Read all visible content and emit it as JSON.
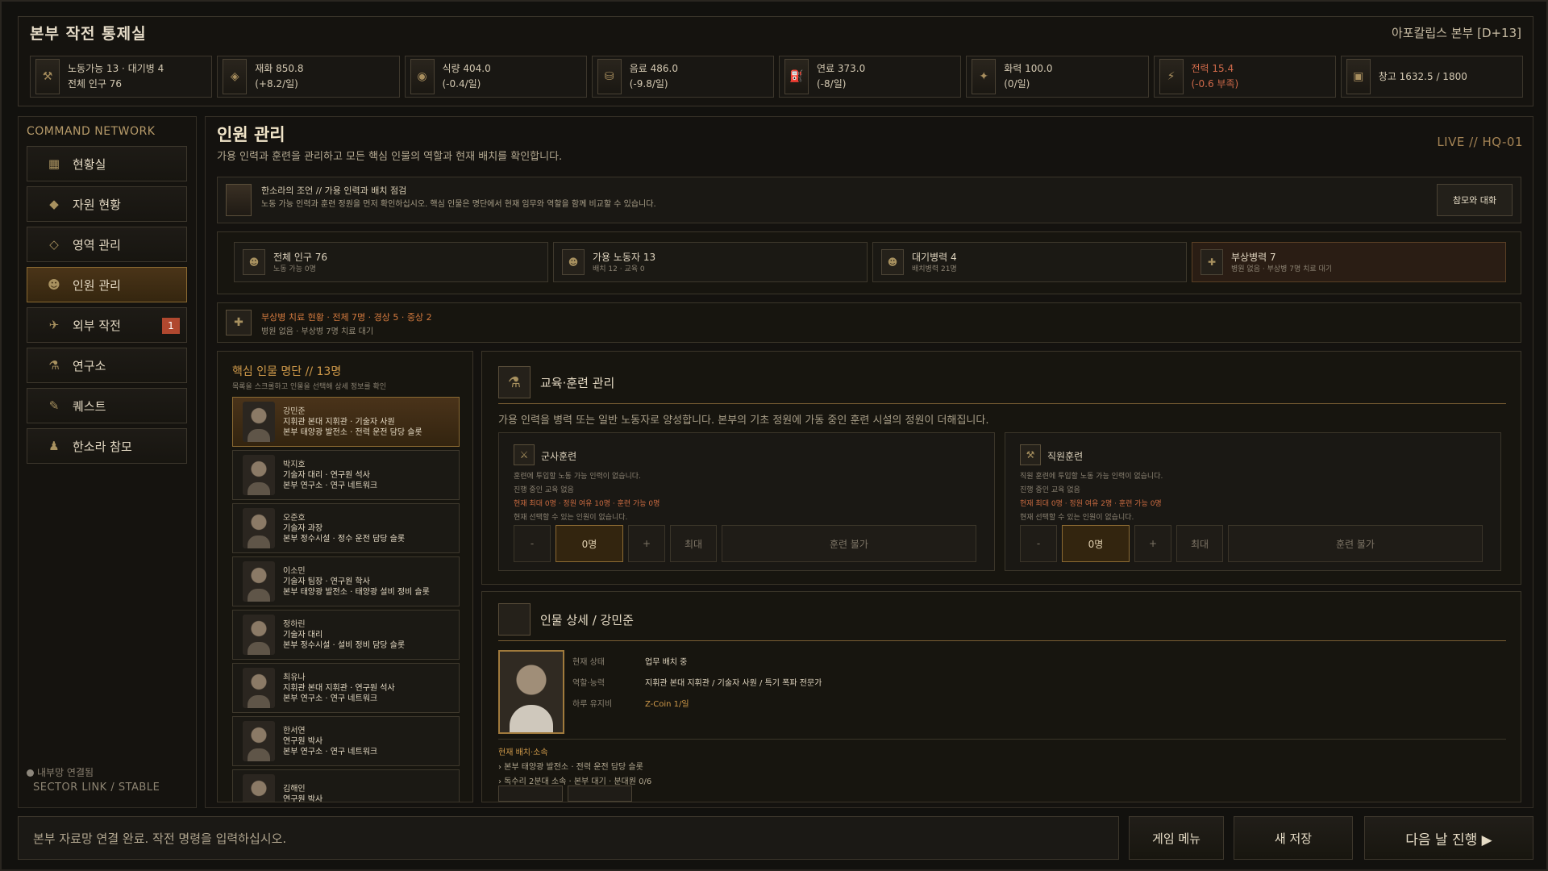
{
  "header": {
    "title": "본부 작전 통제실",
    "status": "아포칼립스 본부 [D+13]"
  },
  "resources": [
    {
      "icon": "worker-icon",
      "line1": "노동가능 13 · 대기병 4",
      "line2": "전체 인구 76",
      "neg": false
    },
    {
      "icon": "material-icon",
      "line1": "재화 850.8",
      "line2": "(+8.2/일)",
      "neg": false
    },
    {
      "icon": "food-icon",
      "line1": "식량 404.0",
      "line2": "(-0.4/일)",
      "neg": false
    },
    {
      "icon": "water-icon",
      "line1": "음료 486.0",
      "line2": "(-9.8/일)",
      "neg": false
    },
    {
      "icon": "fuel-icon",
      "line1": "연료 373.0",
      "line2": "(-8/일)",
      "neg": false
    },
    {
      "icon": "firepower-icon",
      "line1": "화력 100.0",
      "line2": "(0/일)",
      "neg": false
    },
    {
      "icon": "power-icon",
      "line1": "전력 15.4",
      "line2": "(-0.6 부족)",
      "neg": true
    },
    {
      "icon": "storage-icon",
      "line1": "창고 1632.5 / 1800",
      "line2": "",
      "neg": false
    }
  ],
  "sidebar": {
    "title": "COMMAND NETWORK",
    "items": [
      {
        "label": "현황실",
        "icon": "status-room-icon",
        "active": false
      },
      {
        "label": "자원 현황",
        "icon": "resource-icon",
        "active": false
      },
      {
        "label": "영역 관리",
        "icon": "territory-icon",
        "active": false
      },
      {
        "label": "인원 관리",
        "icon": "personnel-icon",
        "active": true
      },
      {
        "label": "외부 작전",
        "icon": "operation-icon",
        "active": false,
        "badge": "1"
      },
      {
        "label": "연구소",
        "icon": "lab-icon",
        "active": false
      },
      {
        "label": "퀘스트",
        "icon": "quest-icon",
        "active": false
      },
      {
        "label": "한소라 참모",
        "icon": "advisor-icon",
        "active": false
      }
    ],
    "net_status": "내부망 연결됨",
    "sector": "SECTOR LINK / STABLE"
  },
  "main": {
    "title": "인원 관리",
    "desc": "가용 인력과 훈련을 관리하고 모든 핵심 인물의 역할과 현재 배치를 확인합니다.",
    "live": "LIVE  //  HQ-01"
  },
  "advisor": {
    "title": "한소라의 조언  //  가용 인력과 배치 점검",
    "text": "노동 가능 인력과 훈련 정원을 먼저 확인하십시오. 핵심 인물은 명단에서 현재 임무와 역할을 함께 비교할 수 있습니다.",
    "button": "참모와 대화"
  },
  "population": [
    {
      "main": "전체 인구 76",
      "sub": "노동 가능 0명",
      "wounded": false
    },
    {
      "main": "가용 노동자 13",
      "sub": "배치 12 · 교육 0",
      "wounded": false
    },
    {
      "main": "대기병력 4",
      "sub": "배치병력 21명",
      "wounded": false
    },
    {
      "main": "부상병력 7",
      "sub": "병원 없음 · 부상병 7명 치료 대기",
      "wounded": true
    }
  ],
  "wound_status": {
    "title": "부상병 치료 현황 · 전체 7명 · 경상 5 · 중상 2",
    "sub": "병원 없음 · 부상병 7명 치료 대기"
  },
  "roster": {
    "title": "핵심 인물 명단  //  13명",
    "sub": "목록을 스크롤하고 인물을 선택해 상세 정보를 확인",
    "people": [
      {
        "name": "강민준",
        "role": "지휘관 본대 지휘관 · 기술자 사원",
        "post": "본부 태양광 발전소 · 전력 운전 담당 슬롯",
        "selected": true
      },
      {
        "name": "박지호",
        "role": "기술자 대리 · 연구원 석사",
        "post": "본부 연구소 · 연구 네트워크",
        "selected": false
      },
      {
        "name": "오준호",
        "role": "기술자 과장",
        "post": "본부 정수시설 · 정수 운전 담당 슬롯",
        "selected": false
      },
      {
        "name": "이소민",
        "role": "기술자 팀장 · 연구원 학사",
        "post": "본부 태양광 발전소 · 태양광 설비 정비 슬롯",
        "selected": false
      },
      {
        "name": "정하린",
        "role": "기술자 대리",
        "post": "본부 정수시설 · 설비 정비 담당 슬롯",
        "selected": false
      },
      {
        "name": "최유나",
        "role": "지휘관 본대 지휘관 · 연구원 석사",
        "post": "본부 연구소 · 연구 네트워크",
        "selected": false
      },
      {
        "name": "한서연",
        "role": "연구원 박사",
        "post": "본부 연구소 · 연구 네트워크",
        "selected": false
      },
      {
        "name": "김해인",
        "role": "연구원 박사",
        "post": "",
        "selected": false
      }
    ]
  },
  "training": {
    "title": "교육·훈련 관리",
    "desc": "가용 인력을 병력 또는 일반 노동자로 양성합니다. 본부의 기초 정원에 가동 중인 훈련 시설의 정원이 더해집니다.",
    "cards": [
      {
        "title": "군사훈련",
        "l1": "훈련에 투입할 노동 가능 인력이 없습니다.",
        "l2": "진행 중인 교육 없음",
        "l3": "현재 최대 0명 · 정원 여유 10명 · 훈련 가능 0명",
        "l4": "현재 선택할 수 있는 인원이 없습니다.",
        "minus": "-",
        "value": "0명",
        "plus": "+",
        "max": "최대",
        "action": "훈련 불가"
      },
      {
        "title": "직원훈련",
        "l1": "직원 훈련에 투입할 노동 가능 인력이 없습니다.",
        "l2": "진행 중인 교육 없음",
        "l3": "현재 최대 0명 · 정원 여유 2명 · 훈련 가능 0명",
        "l4": "현재 선택할 수 있는 인원이 없습니다.",
        "minus": "-",
        "value": "0명",
        "plus": "+",
        "max": "최대",
        "action": "훈련 불가"
      }
    ]
  },
  "detail": {
    "title": "인물 상세  /  강민준",
    "rows": [
      {
        "k": "현재 상태",
        "v": "업무 배치 중",
        "gold": false
      },
      {
        "k": "역할·능력",
        "v": "지휘관 본대 지휘관 / 기술자 사원 / 특기 폭파 전문가",
        "gold": false
      },
      {
        "k": "하루 유지비",
        "v": "Z-Coin 1/일",
        "gold": true
      }
    ],
    "assign_title": "현재 배치·소속",
    "assign": [
      "› 본부 태양광 발전소 · 전력 운전 담당 슬롯",
      "› 독수리 2분대 소속 · 본부 대기 · 분대원 0/6"
    ]
  },
  "bottom": {
    "command_text": "본부 자료망 연결 완료. 작전 명령을 입력하십시오.",
    "menu": "게임 메뉴",
    "save": "새 저장",
    "next": "다음 날 진행 ▶"
  }
}
